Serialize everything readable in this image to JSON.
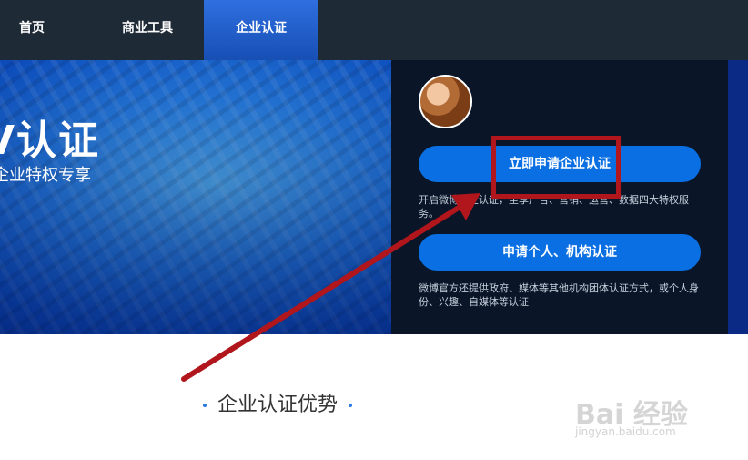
{
  "top_nav": {
    "tabs": [
      {
        "label": "首页"
      },
      {
        "label": "商业工具"
      },
      {
        "label": "企业认证",
        "active": true
      }
    ]
  },
  "hero": {
    "title": "V认证",
    "subtitle": "企业特权专享"
  },
  "panel": {
    "primary_button": "立即申请企业认证",
    "primary_desc": "开启微博企业认证，坐享广告、营销、运营、数据四大特权服务。",
    "secondary_button": "申请个人、机构认证",
    "secondary_desc": "微博官方还提供政府、媒体等其他机构团体认证方式，或个人身份、兴趣、自媒体等认证"
  },
  "section": {
    "title": "企业认证优势"
  },
  "watermark": {
    "logo_text": "Bai 经验",
    "url_text": "jingyan.baidu.com"
  },
  "colors": {
    "accent": "#0a6fe3",
    "annotation_red": "#b0161b",
    "nav_bg": "#1f2a37",
    "panel_bg": "#0a1528"
  }
}
